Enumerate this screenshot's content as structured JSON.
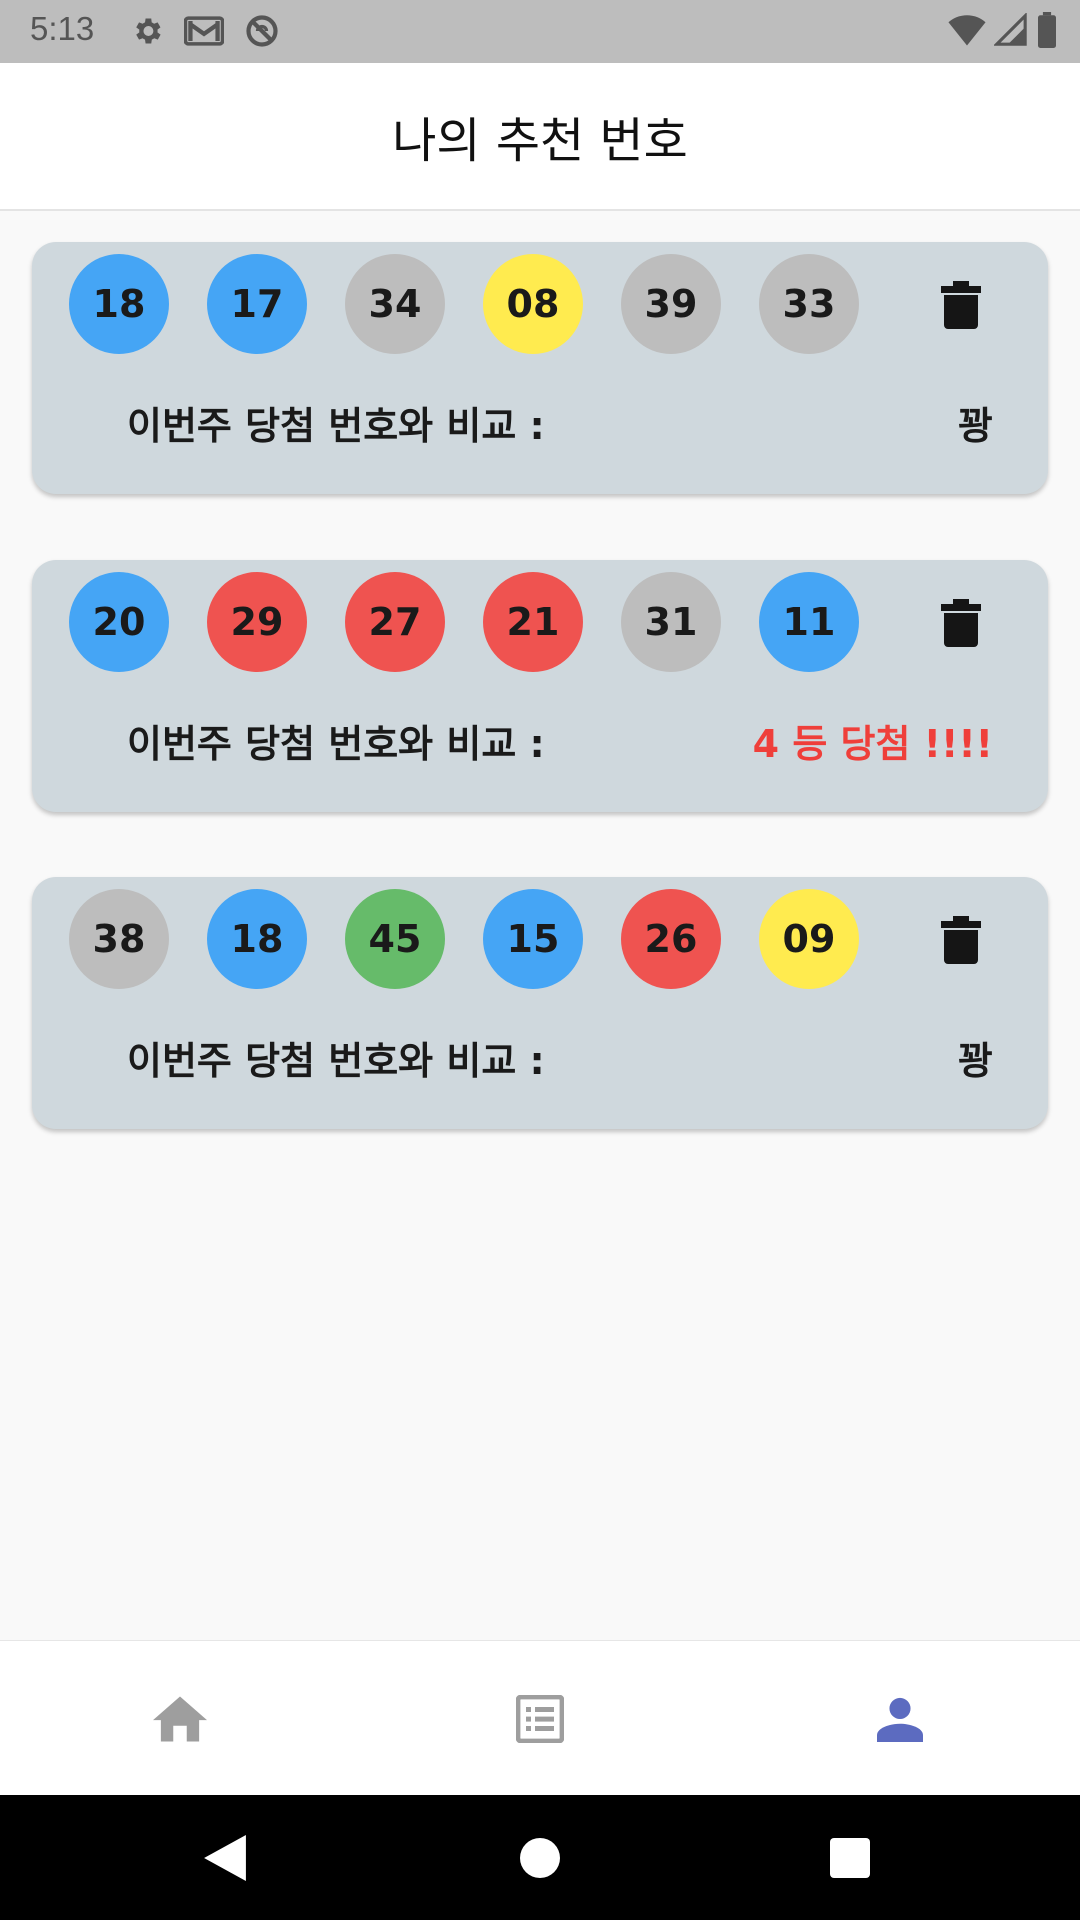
{
  "status_bar": {
    "time": "5:13",
    "left_icons": [
      "gear-icon",
      "gmail-icon",
      "do-not-disturb-icon"
    ],
    "right_icons": [
      "wifi-icon",
      "signal-icon",
      "battery-icon"
    ]
  },
  "header": {
    "title": "나의 추천 번호"
  },
  "cards": [
    {
      "balls": [
        {
          "number": "18",
          "color": "#45a5f5"
        },
        {
          "number": "17",
          "color": "#45a5f5"
        },
        {
          "number": "34",
          "color": "#bdbdbd"
        },
        {
          "number": "08",
          "color": "#ffeb4f"
        },
        {
          "number": "39",
          "color": "#bdbdbd"
        },
        {
          "number": "33",
          "color": "#bdbdbd"
        }
      ],
      "compare_label": "이번주 당첨 번호와 비교 :",
      "result": "꽝",
      "result_color": "#1a1a1a"
    },
    {
      "balls": [
        {
          "number": "20",
          "color": "#45a5f5"
        },
        {
          "number": "29",
          "color": "#ef5350"
        },
        {
          "number": "27",
          "color": "#ef5350"
        },
        {
          "number": "21",
          "color": "#ef5350"
        },
        {
          "number": "31",
          "color": "#bdbdbd"
        },
        {
          "number": "11",
          "color": "#45a5f5"
        }
      ],
      "compare_label": "이번주 당첨 번호와 비교 :",
      "result": "4 등 당첨 !!!!",
      "result_color": "#ef3f3a"
    },
    {
      "balls": [
        {
          "number": "38",
          "color": "#bdbdbd"
        },
        {
          "number": "18",
          "color": "#45a5f5"
        },
        {
          "number": "45",
          "color": "#66bb6a"
        },
        {
          "number": "15",
          "color": "#45a5f5"
        },
        {
          "number": "26",
          "color": "#ef5350"
        },
        {
          "number": "09",
          "color": "#ffeb4f"
        }
      ],
      "compare_label": "이번주 당첨 번호와 비교 :",
      "result": "꽝",
      "result_color": "#1a1a1a"
    }
  ],
  "bottom_nav": {
    "items": [
      {
        "icon": "home-icon",
        "active": false
      },
      {
        "icon": "list-icon",
        "active": false
      },
      {
        "icon": "person-icon",
        "active": true
      }
    ],
    "active_color": "#5c6bc0",
    "inactive_color": "#9e9e9e"
  },
  "system_nav": [
    "back-icon",
    "home-circle-icon",
    "recents-icon"
  ]
}
